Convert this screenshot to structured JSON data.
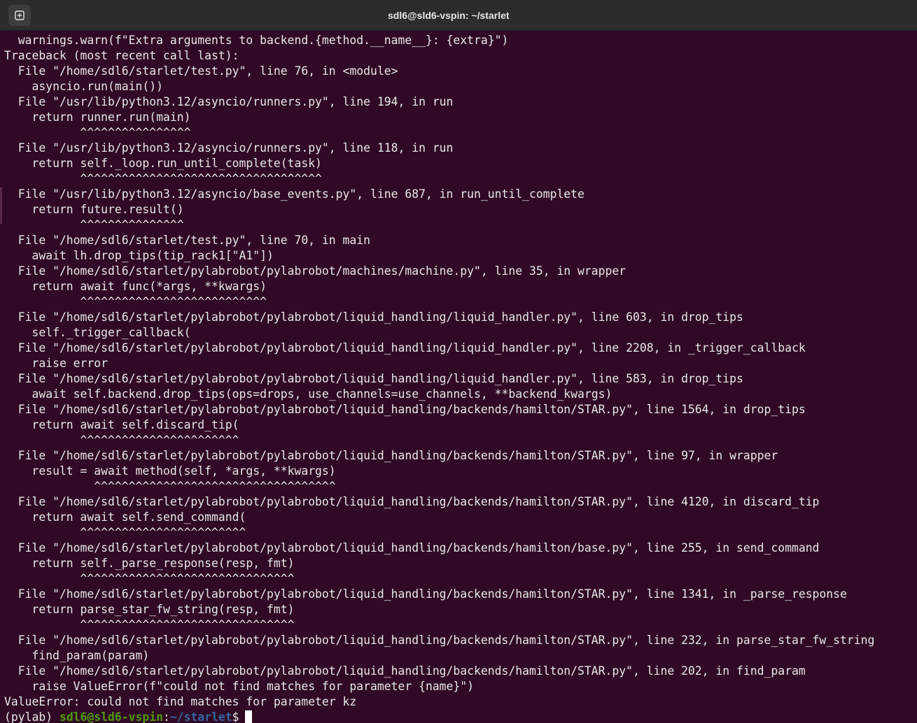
{
  "window": {
    "title": "sdl6@sld6-vspin: ~/starlet"
  },
  "terminal": {
    "lines": [
      "  warnings.warn(f\"Extra arguments to backend.{method.__name__}: {extra}\")",
      "Traceback (most recent call last):",
      "  File \"/home/sdl6/starlet/test.py\", line 76, in <module>",
      "    asyncio.run(main())",
      "  File \"/usr/lib/python3.12/asyncio/runners.py\", line 194, in run",
      "    return runner.run(main)",
      "           ^^^^^^^^^^^^^^^^",
      "  File \"/usr/lib/python3.12/asyncio/runners.py\", line 118, in run",
      "    return self._loop.run_until_complete(task)",
      "           ^^^^^^^^^^^^^^^^^^^^^^^^^^^^^^^^^^^",
      "  File \"/usr/lib/python3.12/asyncio/base_events.py\", line 687, in run_until_complete",
      "    return future.result()",
      "           ^^^^^^^^^^^^^^^",
      "  File \"/home/sdl6/starlet/test.py\", line 70, in main",
      "    await lh.drop_tips(tip_rack1[\"A1\"])",
      "  File \"/home/sdl6/starlet/pylabrobot/pylabrobot/machines/machine.py\", line 35, in wrapper",
      "    return await func(*args, **kwargs)",
      "           ^^^^^^^^^^^^^^^^^^^^^^^^^^^",
      "  File \"/home/sdl6/starlet/pylabrobot/pylabrobot/liquid_handling/liquid_handler.py\", line 603, in drop_tips",
      "    self._trigger_callback(",
      "  File \"/home/sdl6/starlet/pylabrobot/pylabrobot/liquid_handling/liquid_handler.py\", line 2208, in _trigger_callback",
      "    raise error",
      "  File \"/home/sdl6/starlet/pylabrobot/pylabrobot/liquid_handling/liquid_handler.py\", line 583, in drop_tips",
      "    await self.backend.drop_tips(ops=drops, use_channels=use_channels, **backend_kwargs)",
      "  File \"/home/sdl6/starlet/pylabrobot/pylabrobot/liquid_handling/backends/hamilton/STAR.py\", line 1564, in drop_tips",
      "    return await self.discard_tip(",
      "           ^^^^^^^^^^^^^^^^^^^^^^^",
      "  File \"/home/sdl6/starlet/pylabrobot/pylabrobot/liquid_handling/backends/hamilton/STAR.py\", line 97, in wrapper",
      "    result = await method(self, *args, **kwargs)",
      "             ^^^^^^^^^^^^^^^^^^^^^^^^^^^^^^^^^^^",
      "  File \"/home/sdl6/starlet/pylabrobot/pylabrobot/liquid_handling/backends/hamilton/STAR.py\", line 4120, in discard_tip",
      "    return await self.send_command(",
      "           ^^^^^^^^^^^^^^^^^^^^^^^^",
      "  File \"/home/sdl6/starlet/pylabrobot/pylabrobot/liquid_handling/backends/hamilton/base.py\", line 255, in send_command",
      "    return self._parse_response(resp, fmt)",
      "           ^^^^^^^^^^^^^^^^^^^^^^^^^^^^^^^",
      "  File \"/home/sdl6/starlet/pylabrobot/pylabrobot/liquid_handling/backends/hamilton/STAR.py\", line 1341, in _parse_response",
      "    return parse_star_fw_string(resp, fmt)",
      "           ^^^^^^^^^^^^^^^^^^^^^^^^^^^^^^^",
      "  File \"/home/sdl6/starlet/pylabrobot/pylabrobot/liquid_handling/backends/hamilton/STAR.py\", line 232, in parse_star_fw_string",
      "    find_param(param)",
      "  File \"/home/sdl6/starlet/pylabrobot/pylabrobot/liquid_handling/backends/hamilton/STAR.py\", line 202, in find_param",
      "    raise ValueError(f\"could not find matches for parameter {name}\")",
      "ValueError: could not find matches for parameter kz"
    ],
    "prompt": {
      "env": "(pylab) ",
      "user_host": "sdl6@sld6-vspin",
      "separator": ":",
      "path": "~/starlet",
      "symbol": "$"
    }
  },
  "colors": {
    "background": "#300a24",
    "titlebar": "#2c2c2c",
    "prompt_user": "#4e9a06",
    "prompt_path": "#3465a4"
  },
  "icons": {
    "new_tab": "new-tab-icon"
  }
}
